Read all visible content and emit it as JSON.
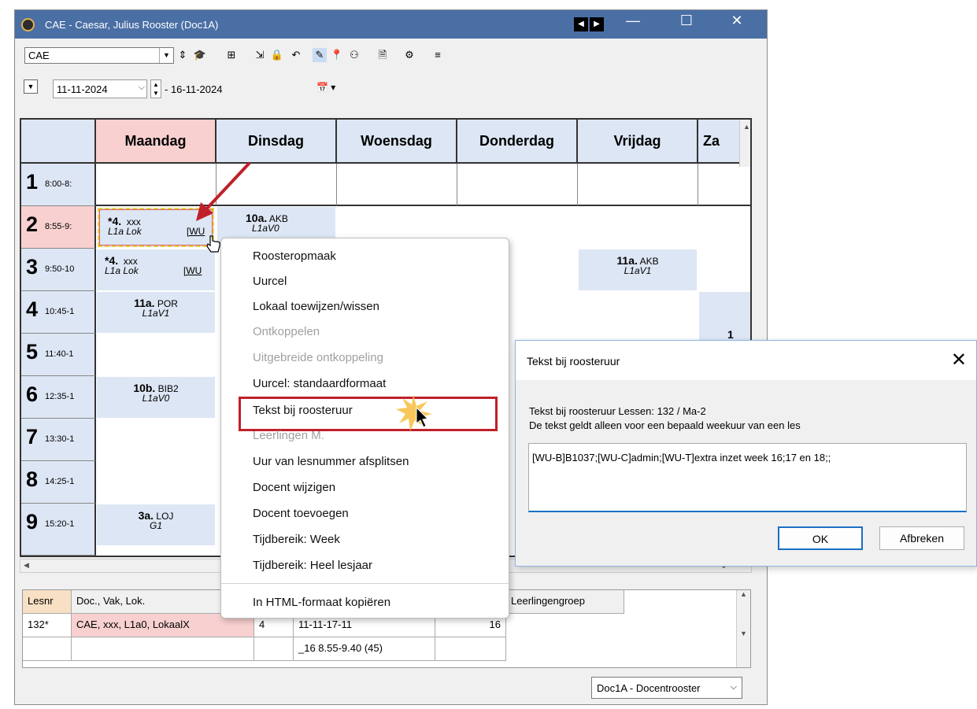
{
  "window": {
    "title": "CAE - Caesar, Julius  Rooster  (Doc1A)",
    "controls": {
      "minimize": "—",
      "maximize": "☐",
      "close": "✕"
    },
    "nav_prev": "◀",
    "nav_next": "▶"
  },
  "toolbar": {
    "element": "CAE"
  },
  "date": {
    "start": "11-11-2024",
    "end": "- 16-11-2024"
  },
  "grid": {
    "days": [
      "Maandag",
      "Dinsdag",
      "Woensdag",
      "Donderdag",
      "Vrijdag",
      "Za"
    ],
    "periods": [
      {
        "num": "1",
        "time": "8:00-8:"
      },
      {
        "num": "2",
        "time": "8:55-9:"
      },
      {
        "num": "3",
        "time": "9:50-10"
      },
      {
        "num": "4",
        "time": "10:45-1"
      },
      {
        "num": "5",
        "time": "11:40-1"
      },
      {
        "num": "6",
        "time": "12:35-1"
      },
      {
        "num": "7",
        "time": "13:30-1"
      },
      {
        "num": "8",
        "time": "14:25-1"
      },
      {
        "num": "9",
        "time": "15:20-1"
      }
    ],
    "lessons": {
      "mo2": {
        "cls": "*4.",
        "subj": "xxx",
        "room": "L1a  Lok",
        "tag": "[WU"
      },
      "mo3": {
        "cls": "*4.",
        "subj": "xxx",
        "room": "L1a  Lok",
        "tag": "[WU"
      },
      "mo4": {
        "cls": "11a.",
        "subj": "POR",
        "room": "L1aV1"
      },
      "mo6": {
        "cls": "10b.",
        "subj": "BIB2",
        "room": "L1aV0"
      },
      "mo9": {
        "cls": "3a.",
        "subj": "LOJ",
        "room": "G1"
      },
      "di2": {
        "cls": "10a.",
        "subj": "AKB",
        "room": "L1aV0"
      },
      "vr3": {
        "cls": "11a.",
        "subj": "AKB",
        "room": "L1aV1"
      },
      "za4": {
        "cls": "1"
      }
    }
  },
  "context_menu": {
    "items": [
      "Roosteropmaak",
      "Uurcel",
      "Lokaal toewijzen/wissen",
      "Ontkoppelen",
      "Uitgebreide ontkoppeling",
      "Uurcel: standaardformaat",
      "Tekst bij roosteruur",
      "Leerlingen M.",
      "Uur van lesnummer afsplitsen",
      "Docent wijzigen",
      "Docent toevoegen",
      "Tijdbereik: Week",
      "Tijdbereik: Heel lesjaar",
      "In HTML-formaat kopiëren"
    ]
  },
  "dialog": {
    "title": "Tekst bij roosteruur",
    "close": "✕",
    "info1": "Tekst bij roosteruur  Lessen: 132 / Ma-2",
    "info2": "De tekst geldt alleen voor een bepaald weekuur van een les",
    "text": "[WU-B]B1037;[WU-C]admin;[WU-T]extra inzet week 16;17 en 18;;",
    "ok": "OK",
    "cancel": "Afbreken"
  },
  "lesson_table": {
    "headers": [
      "Lesnr",
      "Doc., Vak, Lok.",
      "Leerlingengroep"
    ],
    "row1": [
      "132*",
      "CAE, xxx, L1a0, LokaalX",
      "4",
      "11-11-17-11",
      "16"
    ],
    "row2": [
      "_16 8.55-9.40 (45)"
    ]
  },
  "view_select": "Doc1A - Docentrooster"
}
